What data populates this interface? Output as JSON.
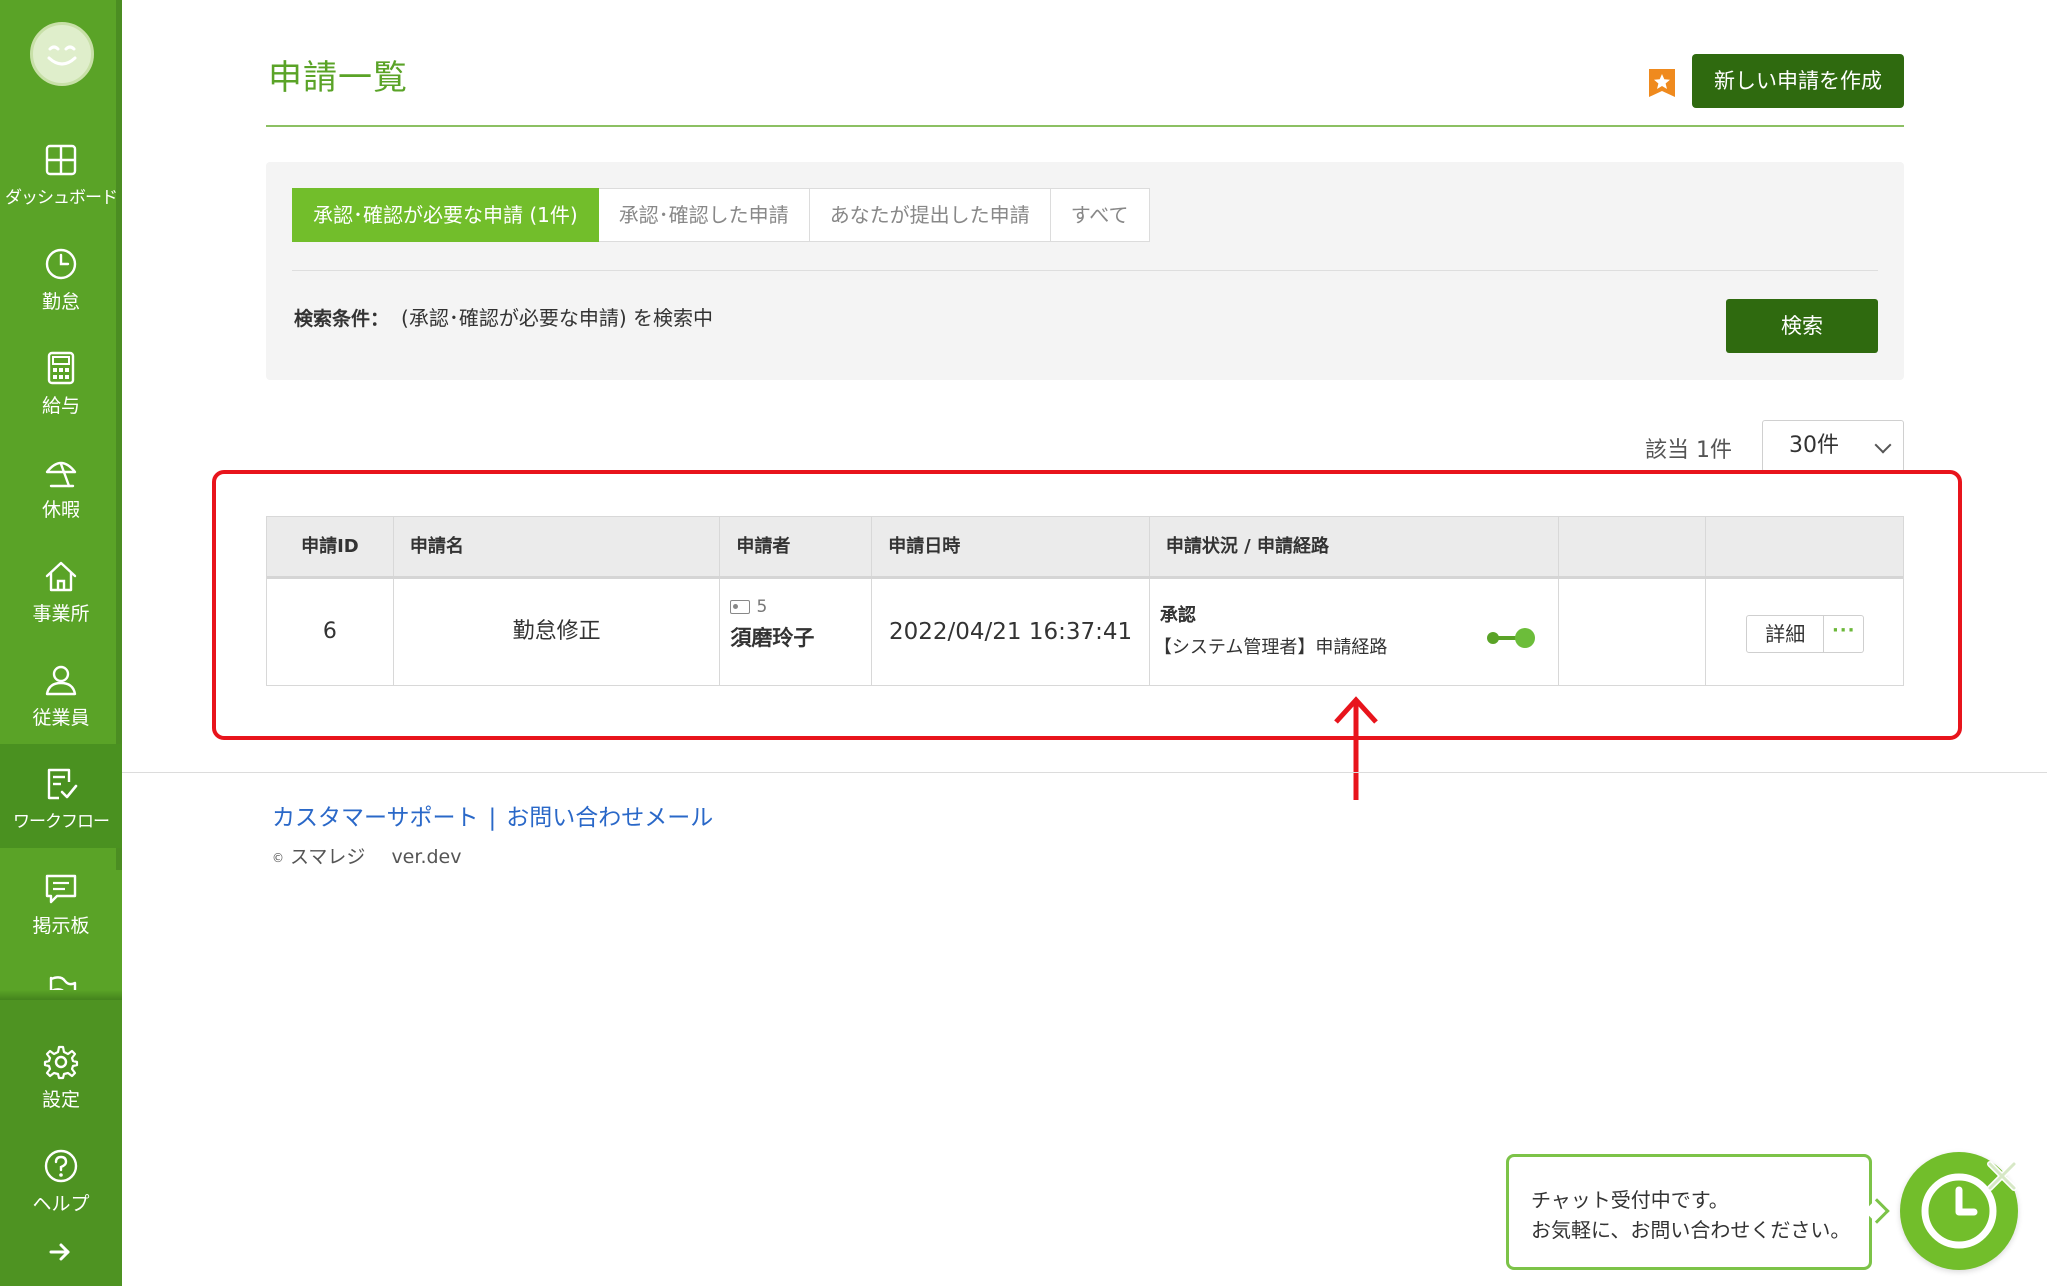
{
  "app": {
    "title": "申請一覧",
    "new_button": "新しい申請を作成",
    "colors": {
      "brand": "#5aa327",
      "brand_dark": "#2f6a0f",
      "tab_active": "#72be2b",
      "highlight": "#e8141c",
      "link": "#2a68c8"
    }
  },
  "sidebar": {
    "items": [
      {
        "label": "ダッシュボード",
        "icon": "dashboard-icon"
      },
      {
        "label": "勤怠",
        "icon": "clock-icon"
      },
      {
        "label": "給与",
        "icon": "calculator-icon"
      },
      {
        "label": "休暇",
        "icon": "parasol-icon"
      },
      {
        "label": "事業所",
        "icon": "home-icon"
      },
      {
        "label": "従業員",
        "icon": "user-icon"
      },
      {
        "label": "ワークフロー",
        "icon": "checklist-icon"
      },
      {
        "label": "掲示板",
        "icon": "chat-icon"
      },
      {
        "label": "設定",
        "icon": "gear-icon"
      },
      {
        "label": "ヘルプ",
        "icon": "help-icon"
      }
    ],
    "active_index": 6
  },
  "filter": {
    "tabs": [
      {
        "label": "承認･確認が必要な申請 (1件)"
      },
      {
        "label": "承認･確認した申請"
      },
      {
        "label": "あなたが提出した申請"
      },
      {
        "label": "すべて"
      }
    ],
    "active_tab": 0,
    "condition_label": "検索条件：",
    "condition_value": "(承認･確認が必要な申請) を検索中",
    "search_button": "検索"
  },
  "results": {
    "count_text": "該当 1件",
    "per_page": "30件"
  },
  "table": {
    "headers": [
      "申請ID",
      "申請名",
      "申請者",
      "申請日時",
      "申請状況 / 申請経路",
      "",
      ""
    ],
    "rows": [
      {
        "id": "6",
        "name": "勤怠修正",
        "applicant_id": "5",
        "applicant_name": "須磨玲子",
        "datetime": "2022/04/21 16:37:41",
        "status": "承認",
        "route": "【システム管理者】申請経路",
        "detail_button": "詳細",
        "more_button": "···"
      }
    ]
  },
  "footer": {
    "support_link": "カスタマーサポート",
    "separator": "|",
    "mail_link": "お問い合わせメール",
    "copyright_symbol": "©",
    "copyright": "スマレジ",
    "version": "ver.dev"
  },
  "chat": {
    "line1": "チャット受付中です。",
    "line2": "お気軽に、お問い合わせください。"
  }
}
